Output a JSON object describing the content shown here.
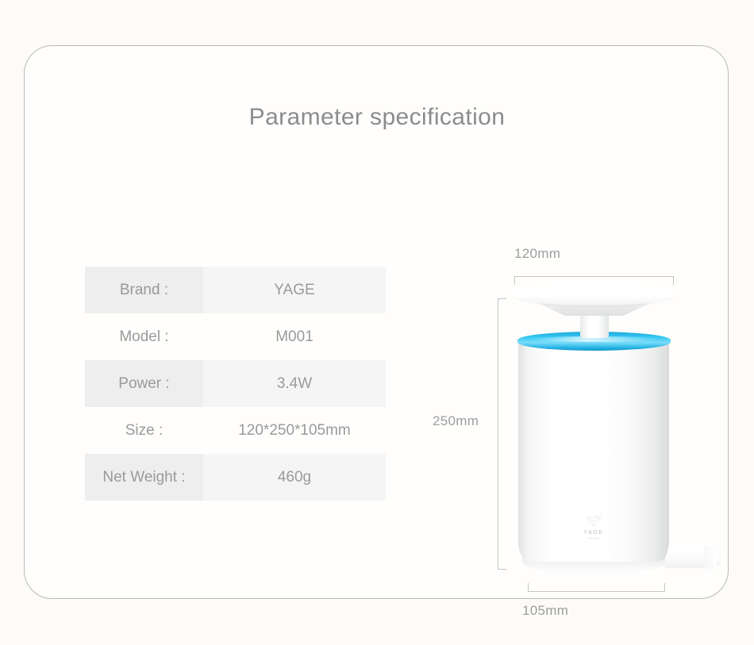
{
  "page": {
    "title": "Parameter specification",
    "background_color": "#fdfbf8",
    "card_border_color": "#b9b9b9",
    "text_color": "#9a9a9a",
    "accent_color": "#37c8f2"
  },
  "spec_table": {
    "rows": [
      {
        "label": "Brand :",
        "value": "YAGE"
      },
      {
        "label": "Model :",
        "value": "M001"
      },
      {
        "label": "Power :",
        "value": "3.4W"
      },
      {
        "label": "Size :",
        "value": "120*250*105mm"
      },
      {
        "label": "Net Weight :",
        "value": "460g"
      }
    ]
  },
  "product": {
    "dimensions": {
      "top": "120mm",
      "left": "250mm",
      "bottom": "105mm"
    },
    "brand_mark": {
      "name": "YAGE",
      "sub": "YAGE"
    }
  }
}
